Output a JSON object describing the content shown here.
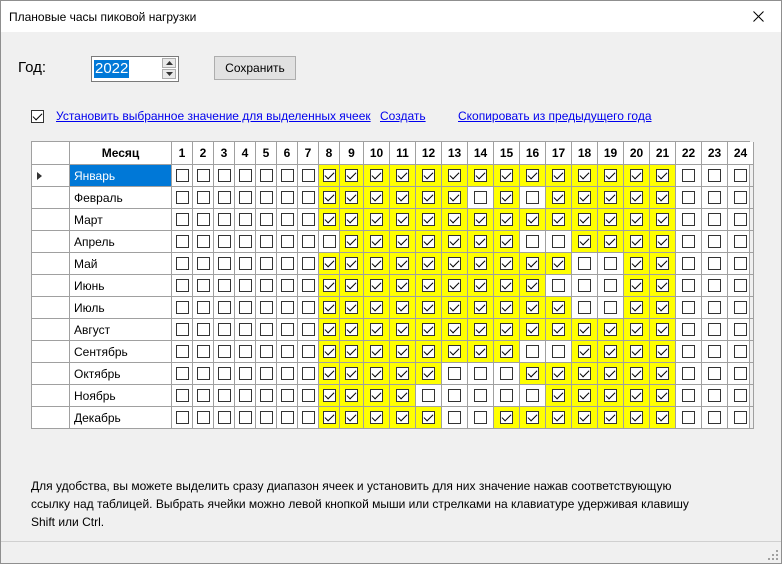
{
  "window": {
    "title": "Плановые часы пиковой нагрузки"
  },
  "year": {
    "label": "Год:",
    "value": "2022"
  },
  "save_label": "Сохранить",
  "options": {
    "apply_checked": true,
    "link_apply": "Установить выбранное значение для выделенных ячеек",
    "link_create": "Создать",
    "link_copy": "Скопировать из предыдущего года"
  },
  "grid": {
    "month_header": "Месяц",
    "hours": [
      "1",
      "2",
      "3",
      "4",
      "5",
      "6",
      "7",
      "8",
      "9",
      "10",
      "11",
      "12",
      "13",
      "14",
      "15",
      "16",
      "17",
      "18",
      "19",
      "20",
      "21",
      "22",
      "23",
      "24"
    ],
    "selected_row": 0,
    "rows": [
      {
        "month": "Январь",
        "on": [
          8,
          9,
          10,
          11,
          12,
          13,
          14,
          15,
          16,
          17,
          18,
          19,
          20,
          21
        ]
      },
      {
        "month": "Февраль",
        "on": [
          8,
          9,
          10,
          11,
          12,
          13,
          15,
          17,
          18,
          19,
          20,
          21
        ]
      },
      {
        "month": "Март",
        "on": [
          8,
          9,
          10,
          11,
          12,
          13,
          14,
          15,
          16,
          17,
          18,
          19,
          20,
          21
        ]
      },
      {
        "month": "Апрель",
        "on": [
          9,
          10,
          11,
          12,
          13,
          14,
          15,
          18,
          19,
          20,
          21
        ]
      },
      {
        "month": "Май",
        "on": [
          8,
          9,
          10,
          11,
          12,
          13,
          14,
          15,
          16,
          17,
          20,
          21
        ]
      },
      {
        "month": "Июнь",
        "on": [
          8,
          9,
          10,
          11,
          12,
          13,
          14,
          15,
          16,
          20,
          21
        ]
      },
      {
        "month": "Июль",
        "on": [
          8,
          9,
          10,
          11,
          12,
          13,
          14,
          15,
          16,
          17,
          20,
          21
        ]
      },
      {
        "month": "Август",
        "on": [
          8,
          9,
          10,
          11,
          12,
          13,
          14,
          15,
          16,
          17,
          18,
          19,
          20,
          21
        ]
      },
      {
        "month": "Сентябрь",
        "on": [
          8,
          9,
          10,
          11,
          12,
          13,
          14,
          15,
          18,
          19,
          20,
          21
        ]
      },
      {
        "month": "Октябрь",
        "on": [
          8,
          9,
          10,
          11,
          12,
          16,
          17,
          18,
          19,
          20,
          21
        ]
      },
      {
        "month": "Ноябрь",
        "on": [
          8,
          9,
          10,
          11,
          17,
          18,
          19,
          20,
          21
        ]
      },
      {
        "month": "Декабрь",
        "on": [
          8,
          9,
          10,
          11,
          12,
          15,
          16,
          17,
          18,
          19,
          20,
          21
        ]
      }
    ]
  },
  "help_text": "Для удобства, вы можете выделить сразу диапазон ячеек и установить для них значение нажав соответствующую ссылку над таблицей. Выбрать ячейки можно левой кнопкой мыши или стрелками на клавиатуре удерживая клавишу Shift или Ctrl."
}
